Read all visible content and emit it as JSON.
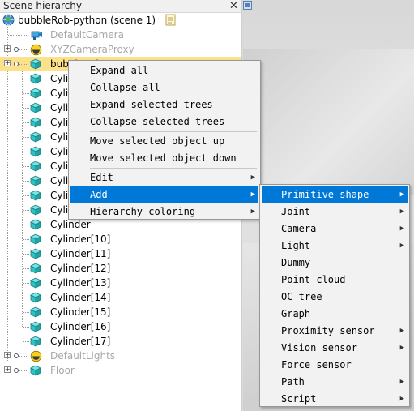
{
  "panel": {
    "title": "Scene hierarchy",
    "close_glyph": "✕"
  },
  "tree": {
    "scene": "bubbleRob-python (scene 1)",
    "items": [
      {
        "label": "DefaultCamera",
        "icon": "camera-icon",
        "dim": true
      },
      {
        "label": "XYZCameraProxy",
        "icon": "light-icon",
        "dim": true
      },
      {
        "label": "bubbleRob",
        "icon": "cube-icon",
        "selected": true
      },
      {
        "label": "Cylinder",
        "icon": "cube-icon"
      },
      {
        "label": "Cylinder",
        "icon": "cube-icon"
      },
      {
        "label": "Cylinder",
        "icon": "cube-icon"
      },
      {
        "label": "Cylinder",
        "icon": "cube-icon"
      },
      {
        "label": "Cylinder",
        "icon": "cube-icon"
      },
      {
        "label": "Cylinder",
        "icon": "cube-icon"
      },
      {
        "label": "Cylinder",
        "icon": "cube-icon"
      },
      {
        "label": "Cylinder",
        "icon": "cube-icon"
      },
      {
        "label": "Cylinder",
        "icon": "cube-icon"
      },
      {
        "label": "Cylinder",
        "icon": "cube-icon"
      },
      {
        "label": "Cylinder",
        "icon": "cube-icon"
      },
      {
        "label": "Cylinder[10]",
        "icon": "cube-icon"
      },
      {
        "label": "Cylinder[11]",
        "icon": "cube-icon"
      },
      {
        "label": "Cylinder[12]",
        "icon": "cube-icon"
      },
      {
        "label": "Cylinder[13]",
        "icon": "cube-icon"
      },
      {
        "label": "Cylinder[14]",
        "icon": "cube-icon"
      },
      {
        "label": "Cylinder[15]",
        "icon": "cube-icon"
      },
      {
        "label": "Cylinder[16]",
        "icon": "cube-icon"
      },
      {
        "label": "Cylinder[17]",
        "icon": "cube-icon"
      },
      {
        "label": "DefaultLights",
        "icon": "light-icon",
        "dim": true
      },
      {
        "label": "Floor",
        "icon": "cube-icon",
        "dim": true
      }
    ]
  },
  "context_menu": {
    "items": [
      {
        "label": "Expand all"
      },
      {
        "label": "Collapse all"
      },
      {
        "label": "Expand selected trees"
      },
      {
        "label": "Collapse selected trees"
      },
      {
        "label": "Move selected object up"
      },
      {
        "label": "Move selected object down"
      },
      {
        "label": "Edit",
        "submenu": true
      },
      {
        "label": "Add",
        "submenu": true,
        "highlighted": true
      },
      {
        "label": "Hierarchy coloring",
        "submenu": true
      }
    ]
  },
  "add_submenu": {
    "items": [
      {
        "label": "Primitive shape",
        "submenu": true,
        "highlighted": true
      },
      {
        "label": "Joint",
        "submenu": true
      },
      {
        "label": "Camera",
        "submenu": true
      },
      {
        "label": "Light",
        "submenu": true
      },
      {
        "label": "Dummy"
      },
      {
        "label": "Point cloud"
      },
      {
        "label": "OC tree"
      },
      {
        "label": "Graph"
      },
      {
        "label": "Proximity sensor",
        "submenu": true
      },
      {
        "label": "Vision sensor",
        "submenu": true
      },
      {
        "label": "Force sensor"
      },
      {
        "label": "Path",
        "submenu": true
      },
      {
        "label": "Script",
        "submenu": true
      }
    ]
  },
  "colors": {
    "selection": "#fde08a",
    "menu_highlight": "#0078d7",
    "cube_face": "#2fc4c4",
    "dim_text": "#a8a8a8"
  }
}
